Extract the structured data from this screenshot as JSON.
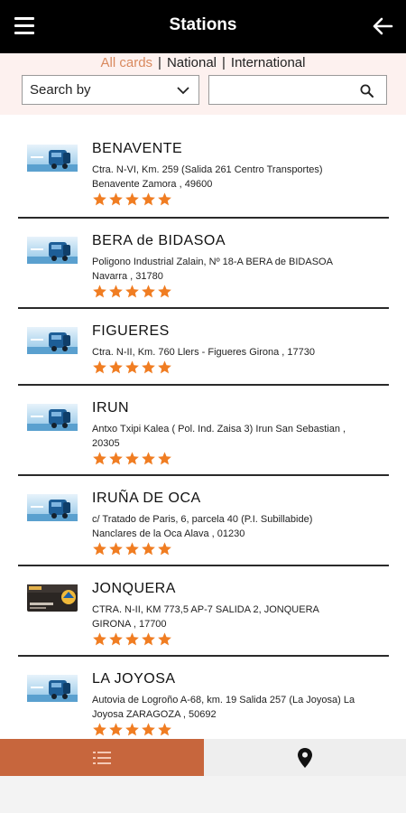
{
  "header": {
    "title": "Stations",
    "menu_icon": "hamburger-menu-icon",
    "back_icon": "arrow-left-icon"
  },
  "filters": {
    "tabs": [
      {
        "label": "All cards",
        "active": true
      },
      {
        "label": "National",
        "active": false
      },
      {
        "label": "International",
        "active": false
      }
    ],
    "separator": "|",
    "select_label": "Search by",
    "search_value": "",
    "accent_color": "#d98a5f"
  },
  "stations": [
    {
      "name": "BENAVENTE",
      "address_line1": "Ctra. N-VI, Km. 259 (Salida 261 Centro Transportes)",
      "address_line2": "Benavente Zamora , 49600",
      "rating": 5,
      "thumb": "truck"
    },
    {
      "name": "BERA de BIDASOA",
      "address_line1": "Poligono Industrial Zalain, Nº 18-A BERA de BIDASOA",
      "address_line2": "Navarra , 31780",
      "rating": 5,
      "thumb": "truck"
    },
    {
      "name": "FIGUERES",
      "address_line1": "Ctra. N-II, Km. 760 Llers - Figueres Girona , 17730",
      "address_line2": "",
      "rating": 5,
      "thumb": "truck"
    },
    {
      "name": "IRUN",
      "address_line1": "Antxo Txipi Kalea ( Pol. Ind. Zaisa 3) Irun San Sebastian ,",
      "address_line2": "20305",
      "rating": 5,
      "thumb": "truck"
    },
    {
      "name": "IRUÑA DE OCA",
      "address_line1": "c/ Tratado de Paris, 6, parcela 40 (P.I. Subillabide)",
      "address_line2": "Nanclares de la Oca Alava , 01230",
      "rating": 5,
      "thumb": "truck"
    },
    {
      "name": "JONQUERA",
      "address_line1": "CTRA. N-II, KM 773,5 AP-7 SALIDA 2, JONQUERA",
      "address_line2": "GIRONA , 17700",
      "rating": 5,
      "thumb": "card"
    },
    {
      "name": "LA JOYOSA",
      "address_line1": "Autovia de Logroño A-68, km. 19 Salida 257 (La Joyosa) La",
      "address_line2": "Joyosa ZARAGOZA , 50692",
      "rating": 5,
      "thumb": "truck"
    }
  ],
  "bottom_nav": {
    "list_icon": "list-icon",
    "map_icon": "map-pin-icon",
    "active_color": "#c7663d"
  },
  "colors": {
    "star": "#f07d22",
    "header_bg": "#000000",
    "filter_bg": "#fdf1ef"
  }
}
